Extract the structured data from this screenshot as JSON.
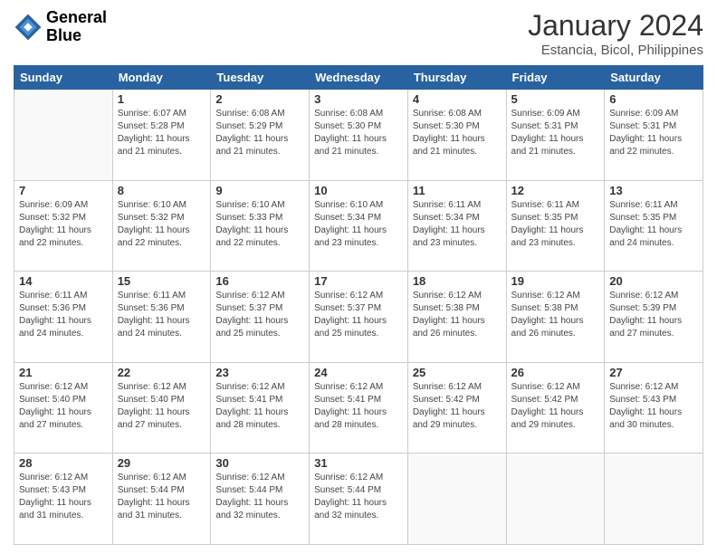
{
  "logo": {
    "line1": "General",
    "line2": "Blue"
  },
  "title": "January 2024",
  "subtitle": "Estancia, Bicol, Philippines",
  "days_header": [
    "Sunday",
    "Monday",
    "Tuesday",
    "Wednesday",
    "Thursday",
    "Friday",
    "Saturday"
  ],
  "weeks": [
    [
      {
        "num": "",
        "info": ""
      },
      {
        "num": "1",
        "info": "Sunrise: 6:07 AM\nSunset: 5:28 PM\nDaylight: 11 hours\nand 21 minutes."
      },
      {
        "num": "2",
        "info": "Sunrise: 6:08 AM\nSunset: 5:29 PM\nDaylight: 11 hours\nand 21 minutes."
      },
      {
        "num": "3",
        "info": "Sunrise: 6:08 AM\nSunset: 5:30 PM\nDaylight: 11 hours\nand 21 minutes."
      },
      {
        "num": "4",
        "info": "Sunrise: 6:08 AM\nSunset: 5:30 PM\nDaylight: 11 hours\nand 21 minutes."
      },
      {
        "num": "5",
        "info": "Sunrise: 6:09 AM\nSunset: 5:31 PM\nDaylight: 11 hours\nand 21 minutes."
      },
      {
        "num": "6",
        "info": "Sunrise: 6:09 AM\nSunset: 5:31 PM\nDaylight: 11 hours\nand 22 minutes."
      }
    ],
    [
      {
        "num": "7",
        "info": "Sunrise: 6:09 AM\nSunset: 5:32 PM\nDaylight: 11 hours\nand 22 minutes."
      },
      {
        "num": "8",
        "info": "Sunrise: 6:10 AM\nSunset: 5:32 PM\nDaylight: 11 hours\nand 22 minutes."
      },
      {
        "num": "9",
        "info": "Sunrise: 6:10 AM\nSunset: 5:33 PM\nDaylight: 11 hours\nand 22 minutes."
      },
      {
        "num": "10",
        "info": "Sunrise: 6:10 AM\nSunset: 5:34 PM\nDaylight: 11 hours\nand 23 minutes."
      },
      {
        "num": "11",
        "info": "Sunrise: 6:11 AM\nSunset: 5:34 PM\nDaylight: 11 hours\nand 23 minutes."
      },
      {
        "num": "12",
        "info": "Sunrise: 6:11 AM\nSunset: 5:35 PM\nDaylight: 11 hours\nand 23 minutes."
      },
      {
        "num": "13",
        "info": "Sunrise: 6:11 AM\nSunset: 5:35 PM\nDaylight: 11 hours\nand 24 minutes."
      }
    ],
    [
      {
        "num": "14",
        "info": "Sunrise: 6:11 AM\nSunset: 5:36 PM\nDaylight: 11 hours\nand 24 minutes."
      },
      {
        "num": "15",
        "info": "Sunrise: 6:11 AM\nSunset: 5:36 PM\nDaylight: 11 hours\nand 24 minutes."
      },
      {
        "num": "16",
        "info": "Sunrise: 6:12 AM\nSunset: 5:37 PM\nDaylight: 11 hours\nand 25 minutes."
      },
      {
        "num": "17",
        "info": "Sunrise: 6:12 AM\nSunset: 5:37 PM\nDaylight: 11 hours\nand 25 minutes."
      },
      {
        "num": "18",
        "info": "Sunrise: 6:12 AM\nSunset: 5:38 PM\nDaylight: 11 hours\nand 26 minutes."
      },
      {
        "num": "19",
        "info": "Sunrise: 6:12 AM\nSunset: 5:38 PM\nDaylight: 11 hours\nand 26 minutes."
      },
      {
        "num": "20",
        "info": "Sunrise: 6:12 AM\nSunset: 5:39 PM\nDaylight: 11 hours\nand 27 minutes."
      }
    ],
    [
      {
        "num": "21",
        "info": "Sunrise: 6:12 AM\nSunset: 5:40 PM\nDaylight: 11 hours\nand 27 minutes."
      },
      {
        "num": "22",
        "info": "Sunrise: 6:12 AM\nSunset: 5:40 PM\nDaylight: 11 hours\nand 27 minutes."
      },
      {
        "num": "23",
        "info": "Sunrise: 6:12 AM\nSunset: 5:41 PM\nDaylight: 11 hours\nand 28 minutes."
      },
      {
        "num": "24",
        "info": "Sunrise: 6:12 AM\nSunset: 5:41 PM\nDaylight: 11 hours\nand 28 minutes."
      },
      {
        "num": "25",
        "info": "Sunrise: 6:12 AM\nSunset: 5:42 PM\nDaylight: 11 hours\nand 29 minutes."
      },
      {
        "num": "26",
        "info": "Sunrise: 6:12 AM\nSunset: 5:42 PM\nDaylight: 11 hours\nand 29 minutes."
      },
      {
        "num": "27",
        "info": "Sunrise: 6:12 AM\nSunset: 5:43 PM\nDaylight: 11 hours\nand 30 minutes."
      }
    ],
    [
      {
        "num": "28",
        "info": "Sunrise: 6:12 AM\nSunset: 5:43 PM\nDaylight: 11 hours\nand 31 minutes."
      },
      {
        "num": "29",
        "info": "Sunrise: 6:12 AM\nSunset: 5:44 PM\nDaylight: 11 hours\nand 31 minutes."
      },
      {
        "num": "30",
        "info": "Sunrise: 6:12 AM\nSunset: 5:44 PM\nDaylight: 11 hours\nand 32 minutes."
      },
      {
        "num": "31",
        "info": "Sunrise: 6:12 AM\nSunset: 5:44 PM\nDaylight: 11 hours\nand 32 minutes."
      },
      {
        "num": "",
        "info": ""
      },
      {
        "num": "",
        "info": ""
      },
      {
        "num": "",
        "info": ""
      }
    ]
  ]
}
